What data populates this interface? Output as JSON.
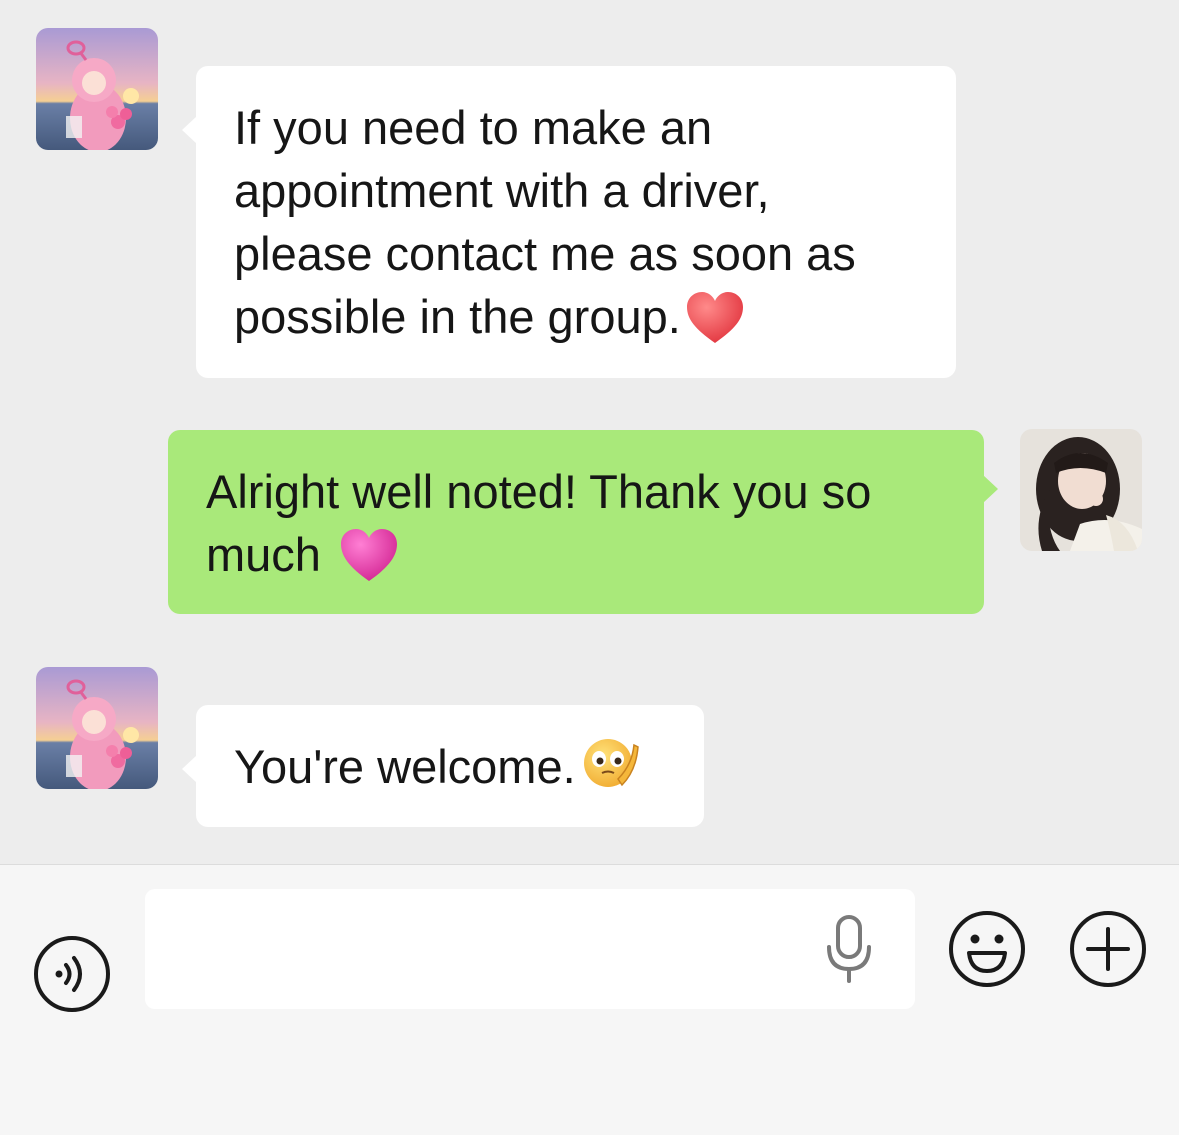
{
  "messages": [
    {
      "direction": "incoming",
      "sender_name": "",
      "avatar": "pink-teletubby-avatar",
      "text": "If you need to make an appointment with a driver, please contact me as soon as possible in the group.",
      "emoji": "red-heart-icon"
    },
    {
      "direction": "outgoing",
      "avatar": "girl-photo-avatar",
      "text": "Alright well noted! Thank you so much",
      "emoji": "pink-heart-icon"
    },
    {
      "direction": "incoming",
      "sender_name": "",
      "avatar": "pink-teletubby-avatar",
      "text": "You're welcome.",
      "emoji": "thinking-face-icon"
    }
  ],
  "input_bar": {
    "voice_icon": "voice-mode-icon",
    "input_value": "",
    "input_placeholder": "",
    "mic_icon": "microphone-icon",
    "emoji_icon": "smiley-face-icon",
    "plus_icon": "plus-circle-icon"
  },
  "colors": {
    "chat_background": "#ededed",
    "incoming_bubble": "#ffffff",
    "outgoing_bubble": "#a9e97a",
    "input_bar_background": "#f6f6f6",
    "icon_stroke": "#1a1a1a"
  }
}
